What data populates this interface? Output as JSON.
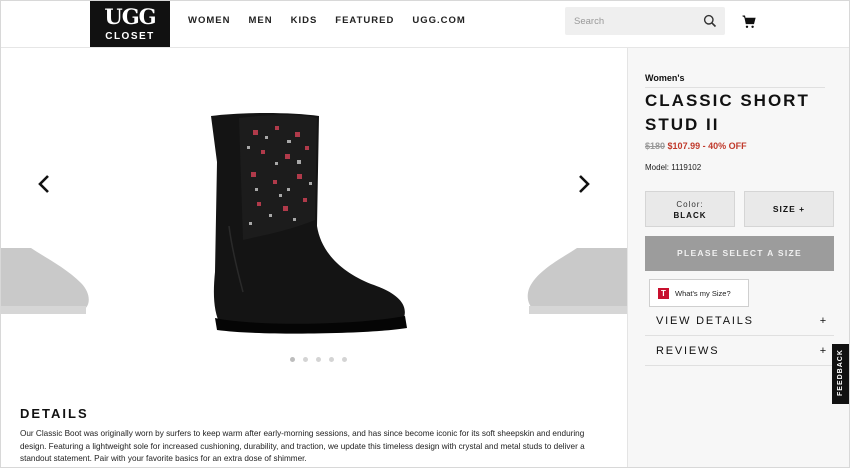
{
  "header": {
    "logo_top": "UGG",
    "logo_bottom": "CLOSET",
    "nav": [
      "WOMEN",
      "MEN",
      "KIDS",
      "FEATURED",
      "UGG.COM"
    ],
    "search_placeholder": "Search"
  },
  "gallery": {
    "dots_count": 5
  },
  "details": {
    "title": "DETAILS",
    "text": "Our Classic Boot was originally worn by surfers to keep warm after early-morning sessions, and has since become iconic for its soft sheepskin and enduring design. Featuring a lightweight sole for increased cushioning, durability, and traction, we update this timeless design with crystal and metal studs to deliver a standout statement. Pair with your favorite basics for an extra dose of shimmer."
  },
  "product": {
    "category": "Women's",
    "name": "CLASSIC SHORT STUD II",
    "price_original": "$180",
    "price_sale": "$107.99",
    "price_discount": "- 40% OFF",
    "model": "Model: 1119102",
    "color_label": "Color:",
    "color_value": "BLACK",
    "size_label": "SIZE +",
    "add_button": "PLEASE SELECT A SIZE",
    "whats_my_size": "What's my Size?",
    "accordion": [
      {
        "title": "VIEW DETAILS",
        "icon": "+"
      },
      {
        "title": "REVIEWS",
        "icon": "+"
      }
    ]
  },
  "feedback": "FEEDBACK",
  "colors": {
    "sale": "#c0392b",
    "disabled_button": "#9c9c9c",
    "logo_bg": "#111111"
  }
}
